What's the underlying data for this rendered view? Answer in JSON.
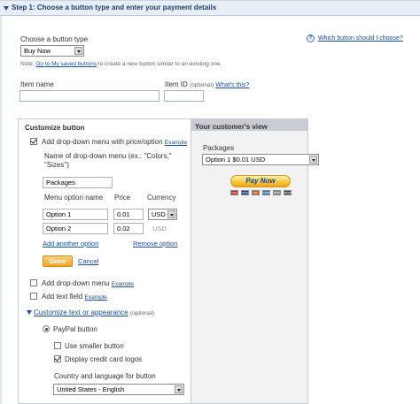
{
  "header": {
    "title": "Step 1: Choose a button type and enter your payment details"
  },
  "button_type": {
    "label": "Choose a button type",
    "value": "Buy Now",
    "note_prefix": "Note:",
    "note_link": "Go to My saved buttons",
    "note_suffix": "to create a new button similar to an existing one.",
    "help_link": "Which button should I choose?"
  },
  "item": {
    "name_label": "Item name",
    "name_value": "",
    "id_label": "Item ID",
    "id_optional": "(optional)",
    "whats_this": "What's this?",
    "id_value": ""
  },
  "customize": {
    "title": "Customize button",
    "dropdown_price_label": "Add drop-down menu with price/option",
    "example": "Example",
    "menu_name_label_1": "Name of drop-down menu (ex.: \"Colors,\"",
    "menu_name_label_2": "\"Sizes\")",
    "menu_name_value": "Packages",
    "col_option": "Menu option name",
    "col_price": "Price",
    "col_currency": "Currency",
    "options": [
      {
        "name": "Option 1",
        "price": "0.01",
        "currency": "USD"
      },
      {
        "name": "Option 2",
        "price": "0.02",
        "currency": "USD"
      }
    ],
    "add_option": "Add another option",
    "remove_option": "Remove option",
    "done": "Done",
    "cancel": "Cancel",
    "add_dropdown": "Add drop-down menu",
    "add_text_field": "Add text field",
    "customize_text": "Customize text or appearance",
    "customize_optional": "(optional)",
    "paypal_button": "PayPal button",
    "smaller_button": "Use smaller button",
    "credit_logos": "Display credit card logos",
    "country_label": "Country and language for button",
    "country_value": "United States - English"
  },
  "customer_view": {
    "title": "Your customer's view",
    "packages_label": "Packages",
    "packages_value": "Option 1 $0.01 USD",
    "pay_now": "Pay Now",
    "cards": [
      "VISA",
      "MC",
      "AMEX",
      "DISC",
      "BANK"
    ]
  },
  "colors": {
    "link": "#1a4f9c",
    "header_bg": "#e8eef6",
    "paynow": "#f8c43a",
    "done": "#f5a623"
  }
}
